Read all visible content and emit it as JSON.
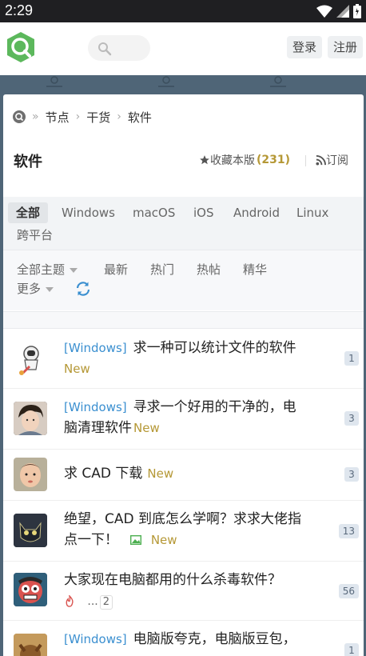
{
  "status": {
    "time": "2:29"
  },
  "header": {
    "login": "登录",
    "register": "注册",
    "search_placeholder": ""
  },
  "breadcrumb": [
    "节点",
    "干货",
    "软件"
  ],
  "node": {
    "title": "软件",
    "fav_label": "收藏本版",
    "fav_count": "(231)",
    "subscribe_label": "订阅"
  },
  "tabs": [
    "全部",
    "Windows",
    "macOS",
    "iOS",
    "Android",
    "Linux",
    "跨平台"
  ],
  "filters": {
    "all_topics": "全部主题",
    "latest": "最新",
    "hot": "热门",
    "hot_posts": "热帖",
    "digest": "精华",
    "more": "更多"
  },
  "topics": [
    {
      "tag": "[Windows]",
      "title": "求一种可以统计文件的软件",
      "badge": "New",
      "count": "1"
    },
    {
      "tag": "[Windows]",
      "title": "寻求一个好用的干净的，电脑清理软件",
      "badge": "New",
      "count": "3"
    },
    {
      "tag": "",
      "title": "求 CAD 下载",
      "badge": "New",
      "count": "3"
    },
    {
      "tag": "",
      "title": "绝望，CAD 到底怎么学啊？求求大佬指点一下！",
      "badge": "New",
      "count": "13"
    },
    {
      "tag": "",
      "title": "大家现在电脑都用的什么杀毒软件？",
      "ellipsis": "...",
      "page": "2",
      "count": "56"
    },
    {
      "tag": "[Windows]",
      "title": "电脑版夸克，电脑版豆包，",
      "count": "1"
    }
  ],
  "colors": {
    "accent": "#3a8fd0",
    "new_badge": "#b59836",
    "logo_green": "#5cb85c"
  }
}
